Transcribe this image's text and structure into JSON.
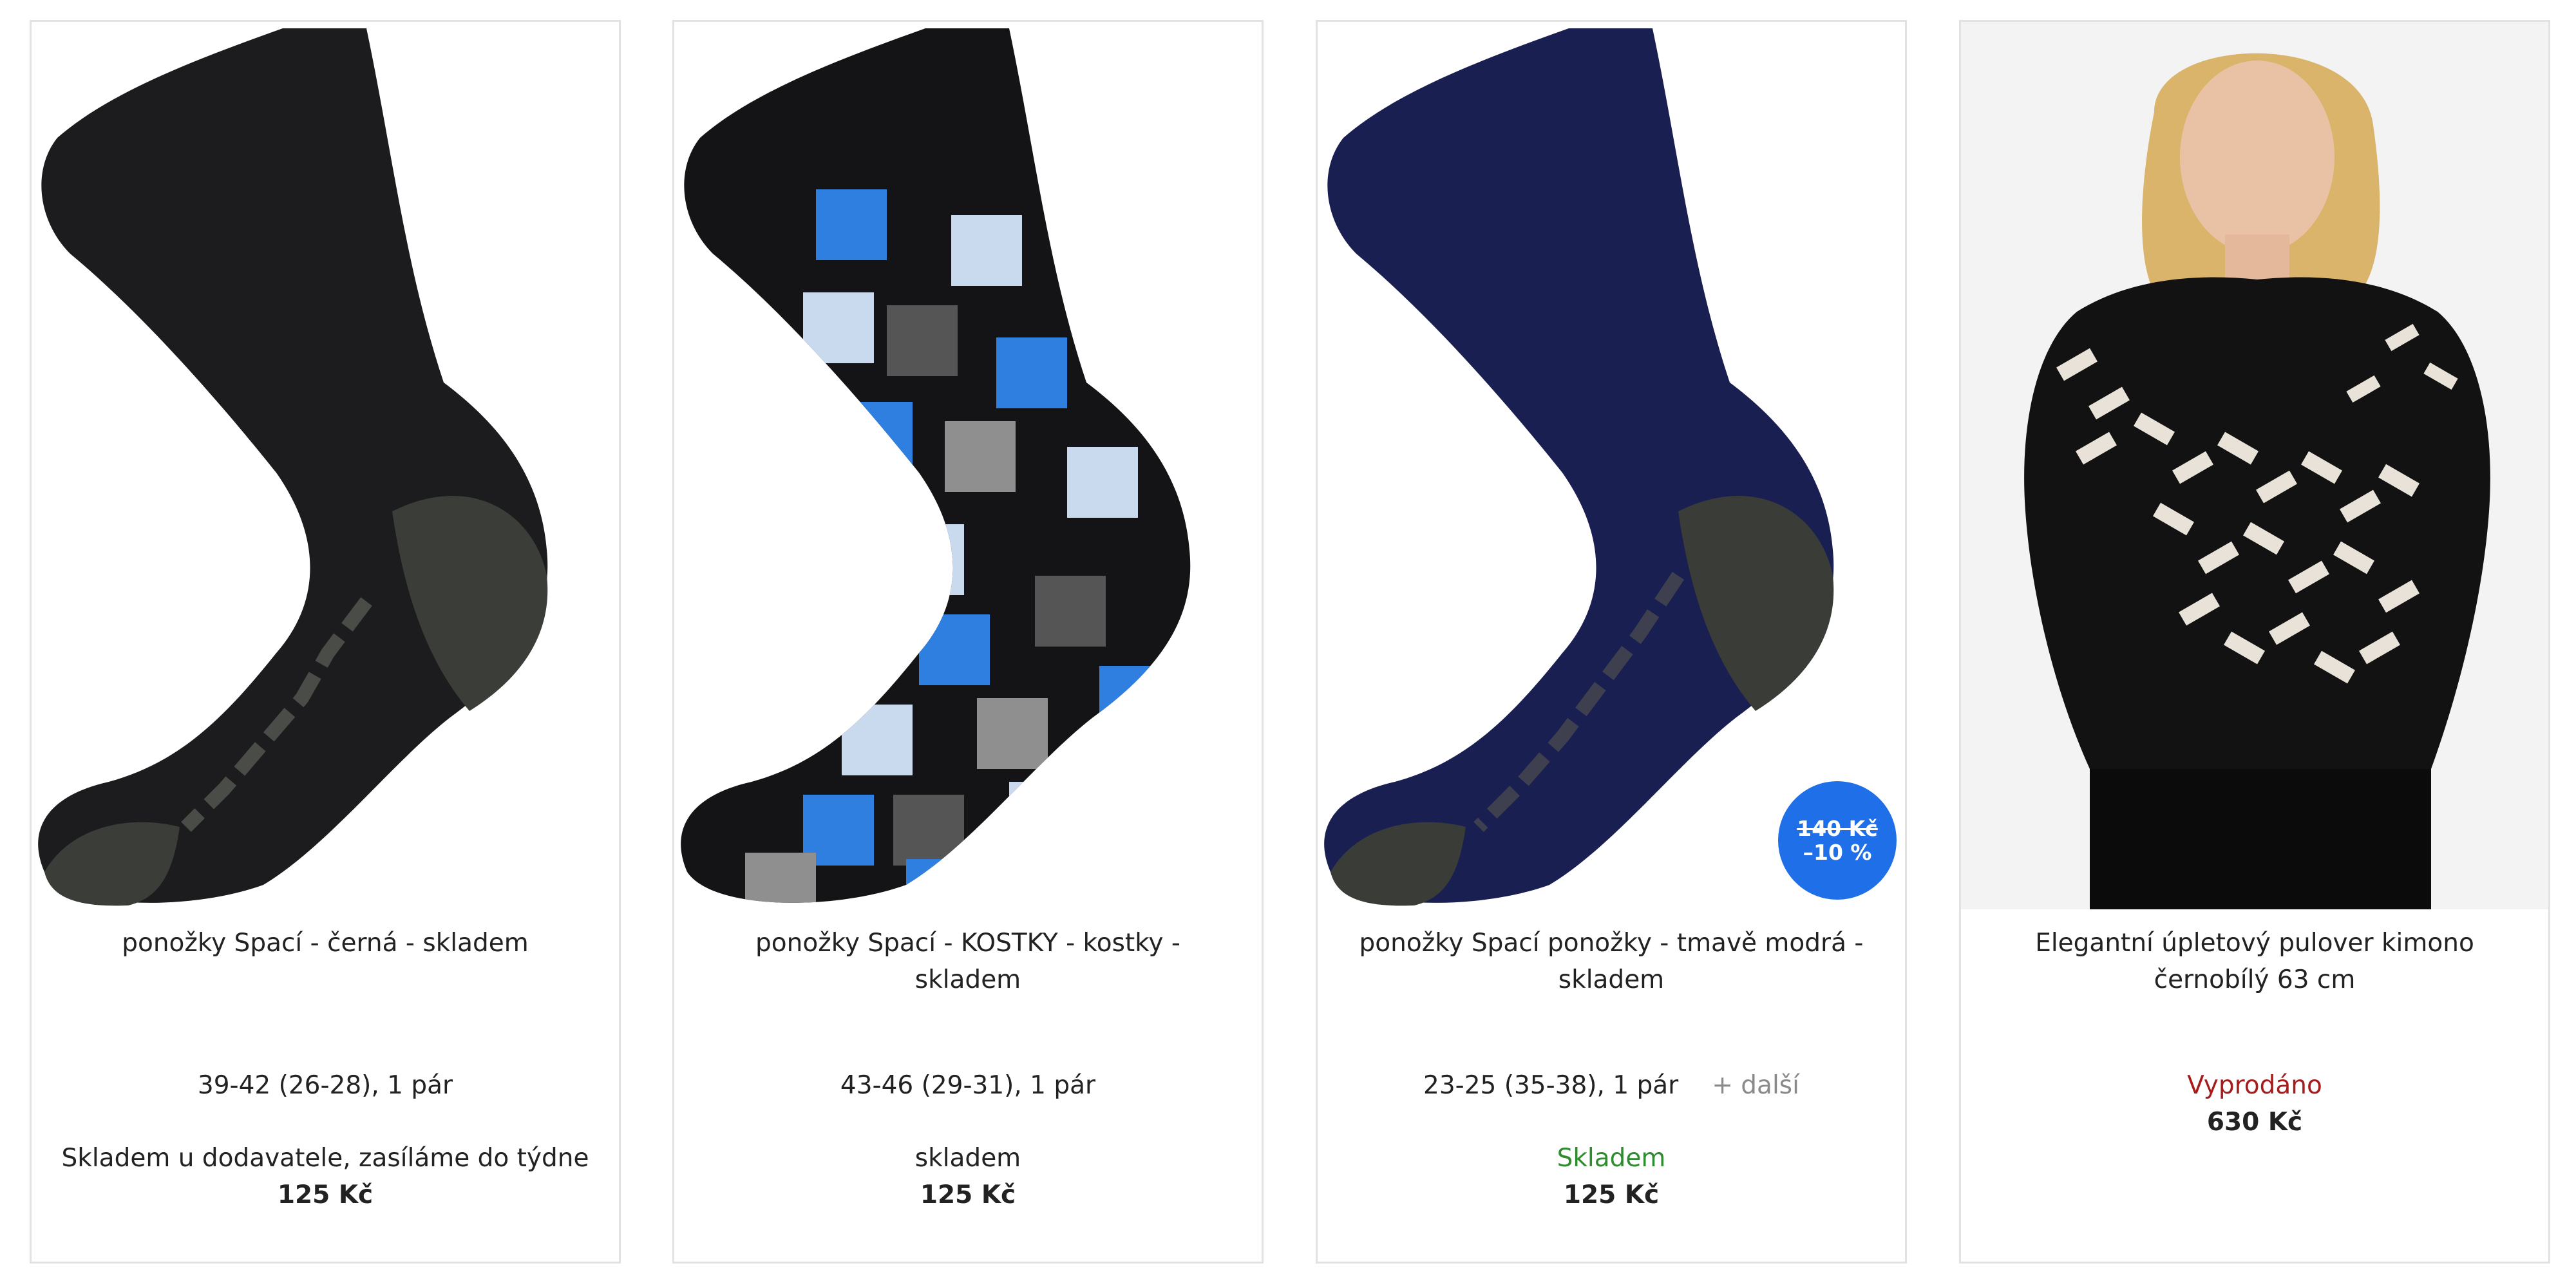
{
  "products": [
    {
      "title": "ponožky Spací - černá - skladem",
      "variant": "39-42 (26-28), 1 pár",
      "availability": "Skladem u dodavatele, zasíláme do týdne",
      "price": "125 Kč",
      "colors": {
        "sock": "#1c1c1e",
        "accent": "#3b3d38"
      }
    },
    {
      "title": "ponožky Spací - KOSTKY - kostky - skladem",
      "variant": "43-46 (29-31), 1 pár",
      "availability": "skladem",
      "price": "125 Kč",
      "colors": {
        "sock": "#141416",
        "blue": "#2f7fe0",
        "light": "#c9d9ee",
        "gray": "#8f8f8f"
      }
    },
    {
      "title": "ponožky Spací ponožky - tmavě modrá - skladem",
      "variant": "23-25 (35-38), 1 pár",
      "more": "+ další",
      "availability": "Skladem",
      "price": "125 Kč",
      "badge": {
        "old_price": "140 Kč",
        "discount": "–10 %"
      },
      "colors": {
        "sock": "#1a1f52",
        "accent": "#3a3c37"
      }
    },
    {
      "title": "Elegantní úpletový pulover kimono černobílý 63 cm",
      "availability": "Vyprodáno",
      "price": "630 Kč",
      "colors": {
        "sweater": "#121212",
        "pattern": "#e8e2d8",
        "hair": "#d9b46a"
      }
    }
  ],
  "colors": {
    "green": "#2e8b2e",
    "red": "#a61b1b",
    "badge": "#1e6fe8",
    "border": "#e2e2e2",
    "muted": "#8a8a8a"
  }
}
